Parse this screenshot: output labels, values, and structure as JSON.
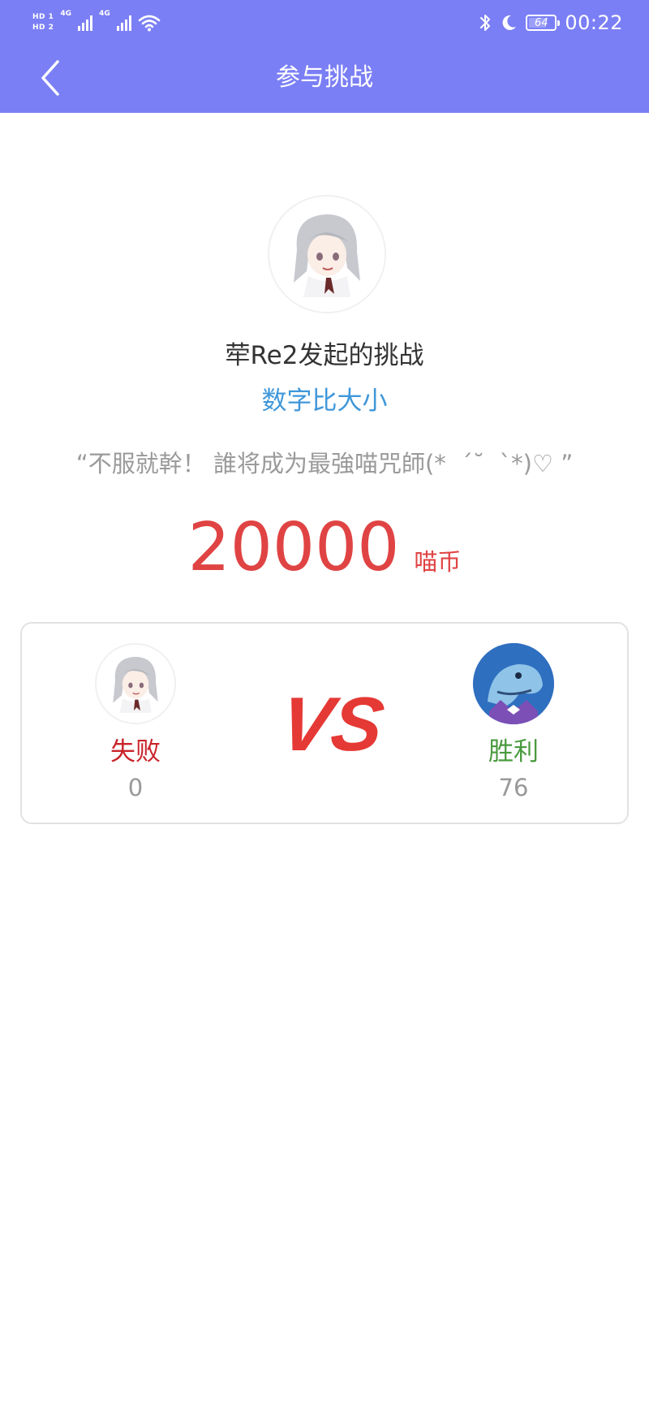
{
  "status_bar": {
    "hd1": "HD 1",
    "hd2": "HD 2",
    "net1": "4G",
    "net2": "4G",
    "battery": "64",
    "time": "00:22",
    "icons": [
      "signal-icon",
      "wifi-icon",
      "bluetooth-icon",
      "moon-icon",
      "battery-icon"
    ]
  },
  "header": {
    "title": "参与挑战",
    "back_icon": "chevron-left-icon",
    "color": "#7b7ff5"
  },
  "challenge": {
    "host_name": "荦Re2发起的挑战",
    "game_name": "数字比大小",
    "slogan": "“不服就幹！ 誰将成为最強喵咒師(*  ´˘  `*)♡ ”",
    "amount": "20000",
    "currency": "喵币"
  },
  "battle": {
    "left": {
      "result": "失败",
      "score": "0",
      "avatar": "anime-girl-avatar"
    },
    "right": {
      "result": "胜利",
      "score": "76",
      "avatar": "dolphin-avatar"
    },
    "vs_text": "VS"
  },
  "colors": {
    "accent_red": "#e04343",
    "lose_red": "#c9242b",
    "win_green": "#4a9a3f",
    "link_blue": "#3f97d9"
  }
}
